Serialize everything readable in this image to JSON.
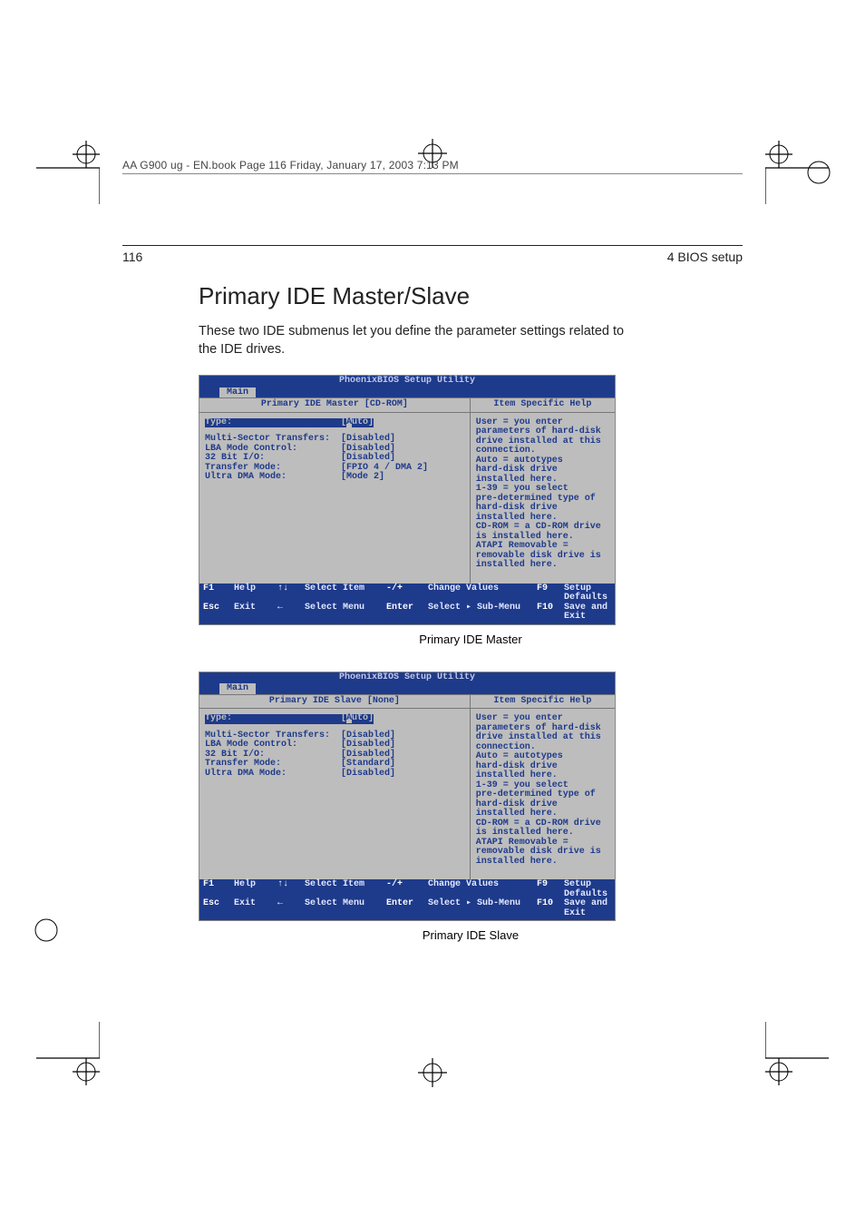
{
  "runhead": "AA G900 ug - EN.book  Page 116  Friday, January 17, 2003  7:13 PM",
  "page_number": "116",
  "chapter": "4 BIOS setup",
  "h1": "Primary IDE Master/Slave",
  "lead": "These two IDE submenus let you define the parameter settings related to the IDE drives.",
  "bios1": {
    "title": "PhoenixBIOS Setup Utility",
    "tab": "Main",
    "subhead_left": "Primary IDE Master  [CD-ROM]",
    "subhead_right": "Item Specific Help",
    "rows": [
      {
        "label": "Type:",
        "value": "[Auto]",
        "sel": true
      },
      {
        "spacer": true
      },
      {
        "label": "Multi-Sector Transfers:",
        "value": "[Disabled]"
      },
      {
        "label": "LBA Mode Control:",
        "value": "[Disabled]"
      },
      {
        "label": "32 Bit I/O:",
        "value": "[Disabled]"
      },
      {
        "label": "Transfer Mode:",
        "value": "[FPIO 4 / DMA 2]"
      },
      {
        "label": "Ultra DMA Mode:",
        "value": "[Mode 2]"
      }
    ],
    "help": "User = you enter\nparameters of hard-disk\ndrive installed at this\nconnection.\nAuto = autotypes\nhard-disk drive\ninstalled here.\n1-39 = you select\npre-determined  type of\nhard-disk drive\ninstalled here.\nCD-ROM = a CD-ROM drive\nis installed here.\nATAPI Removable =\nremovable disk drive is\ninstalled here.",
    "caption": "Primary IDE Master"
  },
  "bios2": {
    "title": "PhoenixBIOS Setup Utility",
    "tab": "Main",
    "subhead_left": "Primary IDE Slave  [None]",
    "subhead_right": "Item Specific Help",
    "rows": [
      {
        "label": "Type:",
        "value": "[Auto]",
        "sel": true
      },
      {
        "spacer": true
      },
      {
        "label": "Multi-Sector Transfers:",
        "value": "[Disabled]"
      },
      {
        "label": "LBA Mode Control:",
        "value": "[Disabled]"
      },
      {
        "label": "32 Bit I/O:",
        "value": "[Disabled]"
      },
      {
        "label": "Transfer Mode:",
        "value": "[Standard]"
      },
      {
        "label": "Ultra DMA Mode:",
        "value": "[Disabled]"
      }
    ],
    "help": "User = you enter\nparameters of hard-disk\ndrive installed at this\nconnection.\nAuto = autotypes\nhard-disk drive\ninstalled here.\n1-39 = you select\npre-determined  type of\nhard-disk drive\ninstalled here.\nCD-ROM = a CD-ROM drive\nis installed here.\nATAPI Removable =\nremovable disk drive is\ninstalled here.",
    "caption": "Primary IDE Slave"
  },
  "footer_keys": {
    "r1": [
      "F1",
      "Help",
      "↑↓",
      "Select Item",
      "-/+",
      "Change Values",
      "F9",
      "Setup Defaults"
    ],
    "r2": [
      "Esc",
      "Exit",
      "←",
      "Select Menu",
      "Enter",
      "Select ▸ Sub-Menu",
      "F10",
      "Save and Exit"
    ]
  }
}
